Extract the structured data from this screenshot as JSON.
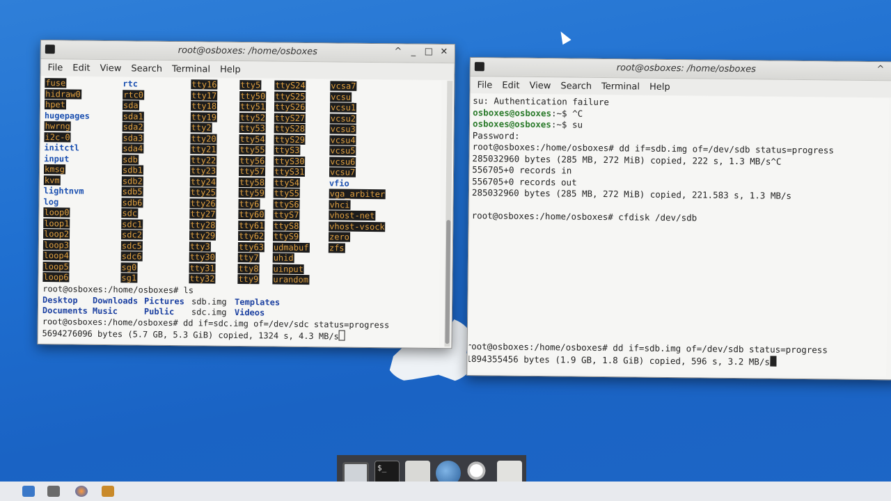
{
  "window1": {
    "title": "root@osboxes: /home/osboxes",
    "menu": [
      "File",
      "Edit",
      "View",
      "Search",
      "Terminal",
      "Help"
    ],
    "dev_columns": [
      [
        "fuse",
        "hidraw0",
        "hpet",
        "hugepages",
        "hwrng",
        "i2c-0",
        "initctl",
        "input",
        "kmsg",
        "kvm",
        "lightnvm",
        "log",
        "loop0",
        "loop1",
        "loop2",
        "loop3",
        "loop4",
        "loop5",
        "loop6"
      ],
      [
        "rtc",
        "rtc0",
        "sda",
        "sda1",
        "sda2",
        "sda3",
        "sda4",
        "sdb",
        "sdb1",
        "sdb2",
        "sdb5",
        "sdb6",
        "sdc",
        "sdc1",
        "sdc2",
        "sdc5",
        "sdc6",
        "sg0",
        "sg1"
      ],
      [
        "tty16",
        "tty17",
        "tty18",
        "tty19",
        "tty2",
        "tty20",
        "tty21",
        "tty22",
        "tty23",
        "tty24",
        "tty25",
        "tty26",
        "tty27",
        "tty28",
        "tty29",
        "tty3",
        "tty30",
        "tty31",
        "tty32"
      ],
      [
        "tty5",
        "tty50",
        "tty51",
        "tty52",
        "tty53",
        "tty54",
        "tty55",
        "tty56",
        "tty57",
        "tty58",
        "tty59",
        "tty6",
        "tty60",
        "tty61",
        "tty62",
        "tty63",
        "tty7",
        "tty8",
        "tty9"
      ],
      [
        "ttyS24",
        "ttyS25",
        "ttyS26",
        "ttyS27",
        "ttyS28",
        "ttyS29",
        "ttyS3",
        "ttyS30",
        "ttyS31",
        "ttyS4",
        "ttyS5",
        "ttyS6",
        "ttyS7",
        "ttyS8",
        "ttyS9",
        "udmabuf",
        "uhid",
        "uinput",
        "urandom"
      ],
      [
        "vcsa7",
        "vcsu",
        "vcsu1",
        "vcsu2",
        "vcsu3",
        "vcsu4",
        "vcsu5",
        "vcsu6",
        "vcsu7",
        "vfio",
        "vga_arbiter",
        "vhci",
        "vhost-net",
        "vhost-vsock",
        "zero",
        "zfs"
      ]
    ],
    "prompt_ls": "root@osboxes:/home/osboxes# ls",
    "ls_row1": [
      "Desktop",
      "Downloads",
      "Pictures",
      "sdb.img",
      "Templates"
    ],
    "ls_row2": [
      "Documents",
      "Music",
      "Public",
      "sdc.img",
      "Videos"
    ],
    "prompt_dd": "root@osboxes:/home/osboxes# dd if=sdc.img of=/dev/sdc status=progress",
    "progress": "5694276096 bytes (5.7 GB, 5.3 GiB) copied, 1324 s, 4.3 MB/s"
  },
  "window2": {
    "title": "root@osboxes: /home/osboxes",
    "menu": [
      "File",
      "Edit",
      "View",
      "Search",
      "Terminal",
      "Help"
    ],
    "line1": "su: Authentication failure",
    "prompt_user": "osboxes@osboxes",
    "prompt_tail1": ":~$ ^C",
    "prompt_tail2": ":~$ su",
    "line_password": "Password:",
    "line_dd": "root@osboxes:/home/osboxes# dd if=sdb.img of=/dev/sdb status=progress",
    "line_copied1": "285032960 bytes (285 MB, 272 MiB) copied, 222 s, 1.3 MB/s^C",
    "line_in": "556705+0 records in",
    "line_out": "556705+0 records out",
    "line_copied2": "285032960 bytes (285 MB, 272 MiB) copied, 221.583 s, 1.3 MB/s",
    "line_cfdisk": "root@osboxes:/home/osboxes# cfdisk /dev/sdb",
    "bottom_prompt": "root@osboxes:/home/osboxes# dd if=sdb.img of=/dev/sdb status=progress",
    "bottom_progress": "1894355456 bytes (1.9 GB, 1.8 GiB) copied, 596 s, 3.2 MB/s"
  },
  "dock": {
    "items": [
      "screen-icon",
      "terminal-icon",
      "folder-icon",
      "globe-icon",
      "search-icon",
      "files-icon"
    ],
    "terminal_glyph": "$_"
  },
  "window_buttons": [
    "^",
    "_",
    "□",
    "✕"
  ],
  "colors": {
    "desktop": "#1f6fd0",
    "prompt_green": "#2a7a2a",
    "dir_blue": "#1a3fa0",
    "dev_highlight": "#1c1c1c",
    "dev_text": "#e0a040"
  }
}
